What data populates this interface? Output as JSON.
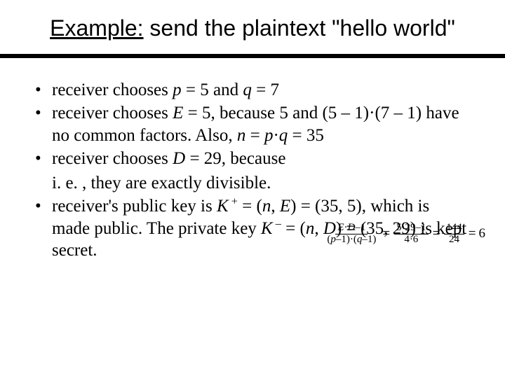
{
  "title": {
    "prefix": "Example:",
    "rest": " send the plaintext \"hello world\""
  },
  "bullets": {
    "b1": {
      "t1": "receiver chooses ",
      "p": "p",
      "eq1": " = 5 and ",
      "q": "q",
      "eq2": " = 7"
    },
    "b2": {
      "t1": "receiver chooses ",
      "E": "E",
      "t2": " = 5, because 5 and (5 – 1)·(7 – 1) have no common factors. Also, ",
      "n": "n",
      "t3": " = ",
      "p": "p",
      "dot": "·",
      "q": "q",
      "t4": " = 35"
    },
    "b3": {
      "t1": "receiver chooses ",
      "D": "D",
      "t2": " = 29, because"
    },
    "sub1": "i. e. , they are exactly divisible.",
    "b4": {
      "t1": "receiver's public key is ",
      "K": "K",
      "sup1": " +",
      "t2": " = (",
      "n": "n",
      "t3": ", ",
      "E": "E",
      "t4": ") = (35, 5), which is made public. The private key ",
      "K2": "K",
      "sup2": " –",
      "t5": " = (",
      "n2": "n",
      "t6": ", ",
      "D": "D",
      "t7": ") = (35, 29) is kept secret."
    }
  },
  "formula": {
    "f1_num_a": "E",
    "f1_num_dot1": "·",
    "f1_num_b": "D",
    "f1_num_rest": "–1",
    "f1_den_lp": "(",
    "f1_den_p": "p",
    "f1_den_m1": "–1)·(",
    "f1_den_q": "q",
    "f1_den_m2": "–1)",
    "eq": "=",
    "f2_num": "5·29–1",
    "f2_den": "4·6",
    "f3_num": "144",
    "f3_den": "24",
    "result": "6"
  }
}
